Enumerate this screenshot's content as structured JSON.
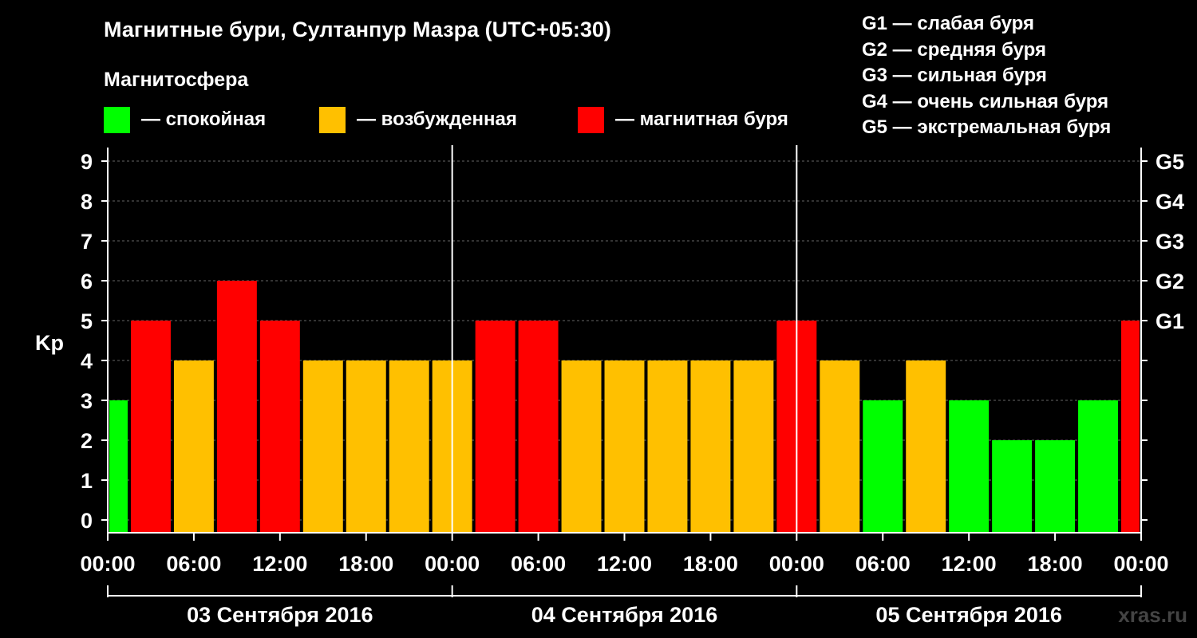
{
  "header": {
    "title": "Магнитные бури, Султанпур Мазра (UTC+05:30)",
    "subtitle": "Магнитосфера"
  },
  "legend": [
    {
      "label": "— спокойная",
      "color": "#00ff00"
    },
    {
      "label": "— возбужденная",
      "color": "#ffc000"
    },
    {
      "label": "— магнитная буря",
      "color": "#ff0000"
    }
  ],
  "g_legend": [
    "G1 — слабая буря",
    "G2 — средняя буря",
    "G3 — сильная буря",
    "G4 — очень сильная буря",
    "G5 — экстремальная буря"
  ],
  "watermark": "xras.ru",
  "chart_data": {
    "type": "bar",
    "ylabel": "Kp",
    "ylim": [
      0,
      9
    ],
    "y_ticks": [
      "0",
      "1",
      "2",
      "3",
      "4",
      "5",
      "6",
      "7",
      "8",
      "9"
    ],
    "g_ticks": [
      {
        "label": "G1",
        "kp": 5
      },
      {
        "label": "G2",
        "kp": 6
      },
      {
        "label": "G3",
        "kp": 7
      },
      {
        "label": "G4",
        "kp": 8
      },
      {
        "label": "G5",
        "kp": 9
      }
    ],
    "x_time_labels": [
      "00:00",
      "06:00",
      "12:00",
      "18:00",
      "00:00",
      "06:00",
      "12:00",
      "18:00",
      "00:00",
      "06:00",
      "12:00",
      "18:00",
      "00:00"
    ],
    "days": [
      "03 Сентября 2016",
      "04 Сентября 2016",
      "05 Сентября 2016"
    ],
    "hours_total": 72,
    "grid": "dashed horizontal",
    "colors": {
      "quiet": "#00ff00",
      "unsettled": "#ffc000",
      "storm": "#ff0000"
    },
    "bars": [
      {
        "start": 0,
        "end": 1.5,
        "kp": 3
      },
      {
        "start": 1.5,
        "end": 4.5,
        "kp": 5
      },
      {
        "start": 4.5,
        "end": 7.5,
        "kp": 4
      },
      {
        "start": 7.5,
        "end": 10.5,
        "kp": 6
      },
      {
        "start": 10.5,
        "end": 13.5,
        "kp": 5
      },
      {
        "start": 13.5,
        "end": 16.5,
        "kp": 4
      },
      {
        "start": 16.5,
        "end": 19.5,
        "kp": 4
      },
      {
        "start": 19.5,
        "end": 22.5,
        "kp": 4
      },
      {
        "start": 22.5,
        "end": 25.5,
        "kp": 4
      },
      {
        "start": 25.5,
        "end": 28.5,
        "kp": 5
      },
      {
        "start": 28.5,
        "end": 31.5,
        "kp": 5
      },
      {
        "start": 31.5,
        "end": 34.5,
        "kp": 4
      },
      {
        "start": 34.5,
        "end": 37.5,
        "kp": 4
      },
      {
        "start": 37.5,
        "end": 40.5,
        "kp": 4
      },
      {
        "start": 40.5,
        "end": 43.5,
        "kp": 4
      },
      {
        "start": 43.5,
        "end": 46.5,
        "kp": 4
      },
      {
        "start": 46.5,
        "end": 49.5,
        "kp": 5
      },
      {
        "start": 49.5,
        "end": 52.5,
        "kp": 4
      },
      {
        "start": 52.5,
        "end": 55.5,
        "kp": 3
      },
      {
        "start": 55.5,
        "end": 58.5,
        "kp": 4
      },
      {
        "start": 58.5,
        "end": 61.5,
        "kp": 3
      },
      {
        "start": 61.5,
        "end": 64.5,
        "kp": 2
      },
      {
        "start": 64.5,
        "end": 67.5,
        "kp": 2
      },
      {
        "start": 67.5,
        "end": 70.5,
        "kp": 3
      },
      {
        "start": 70.5,
        "end": 72,
        "kp": 5
      }
    ]
  }
}
